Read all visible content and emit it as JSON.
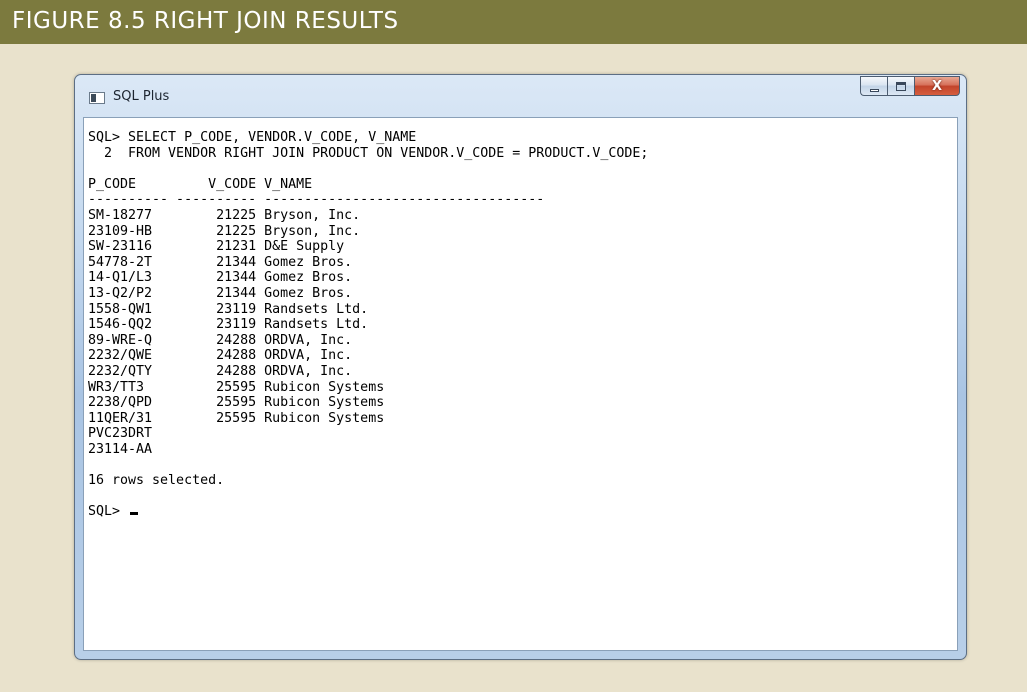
{
  "figure": {
    "title": "FIGURE 8.5  RIGHT JOIN RESULTS"
  },
  "window": {
    "title": "SQL Plus",
    "controls": {
      "minimize_icon": "minimize-icon",
      "maximize_icon": "maximize-icon",
      "close_label": "X"
    }
  },
  "console": {
    "query_line_1": "SQL> SELECT P_CODE, VENDOR.V_CODE, V_NAME",
    "query_line_2": "  2  FROM VENDOR RIGHT JOIN PRODUCT ON VENDOR.V_CODE = PRODUCT.V_CODE;",
    "header_line": "P_CODE         V_CODE V_NAME",
    "separator_line": "---------- ---------- -----------------------------------",
    "rows": [
      "SM-18277        21225 Bryson, Inc.",
      "23109-HB        21225 Bryson, Inc.",
      "SW-23116        21231 D&E Supply",
      "54778-2T        21344 Gomez Bros.",
      "14-Q1/L3        21344 Gomez Bros.",
      "13-Q2/P2        21344 Gomez Bros.",
      "1558-QW1        23119 Randsets Ltd.",
      "1546-QQ2        23119 Randsets Ltd.",
      "89-WRE-Q        24288 ORDVA, Inc.",
      "2232/QWE        24288 ORDVA, Inc.",
      "2232/QTY        24288 ORDVA, Inc.",
      "WR3/TT3         25595 Rubicon Systems",
      "2238/QPD        25595 Rubicon Systems",
      "11QER/31        25595 Rubicon Systems",
      "PVC23DRT",
      "23114-AA"
    ],
    "result_message": "16 rows selected.",
    "prompt": "SQL> "
  },
  "colors": {
    "figure_header_bg": "#7c7a3e",
    "page_bg": "#e9e2cc",
    "console_bg": "#ffffff",
    "close_button": "#c2442b"
  }
}
